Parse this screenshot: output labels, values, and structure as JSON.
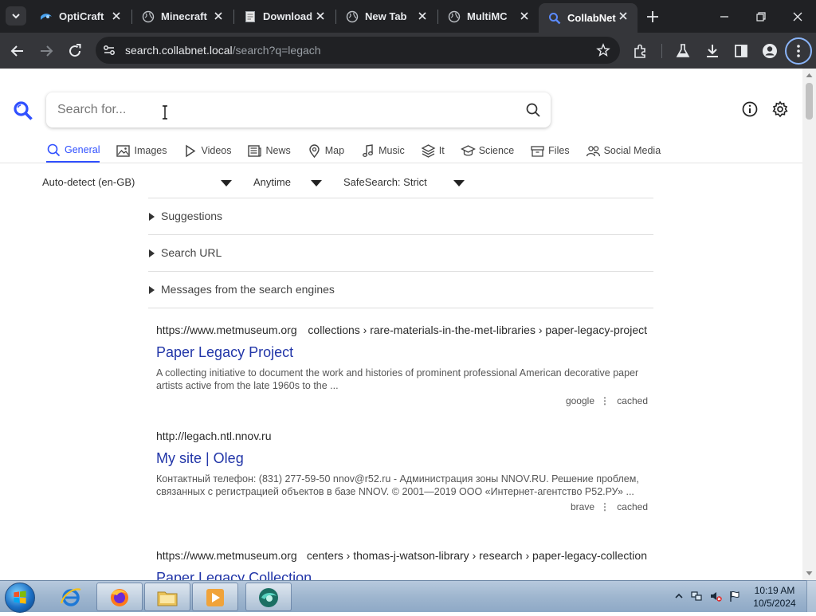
{
  "browser": {
    "tabs": [
      {
        "title": "OptiCraft",
        "icon": "opticraft-favicon",
        "active": false
      },
      {
        "title": "Minecraft",
        "icon": "globe-icon",
        "active": false
      },
      {
        "title": "Download",
        "icon": "document-icon",
        "active": false
      },
      {
        "title": "New Tab",
        "icon": "globe-icon",
        "active": false
      },
      {
        "title": "MultiMC",
        "icon": "globe-icon",
        "active": false
      },
      {
        "title": "CollabNet",
        "icon": "search-favicon",
        "active": true
      }
    ],
    "url_host": "search.collabnet.local",
    "url_path": "/search?q=legach"
  },
  "search": {
    "placeholder": "Search for...",
    "value": "",
    "categories": [
      "General",
      "Images",
      "Videos",
      "News",
      "Map",
      "Music",
      "It",
      "Science",
      "Files",
      "Social Media"
    ],
    "active_category": "General",
    "filters": {
      "language": "Auto-detect (en-GB)",
      "time": "Anytime",
      "safesearch": "SafeSearch: Strict"
    },
    "sections": [
      "Suggestions",
      "Search URL",
      "Messages from the search engines"
    ]
  },
  "results": [
    {
      "host": "https://www.metmuseum.org",
      "crumbs": "collections › rare-materials-in-the-met-libraries › paper-legacy-project",
      "title": "Paper Legacy Project",
      "snippet": "A collecting initiative to document the work and histories of prominent professional American decorative paper artists active from the late 1960s to the ...",
      "engine": "google",
      "cached": "cached"
    },
    {
      "host": "http://legach.ntl.nnov.ru",
      "crumbs": "",
      "title": "My site | Oleg",
      "snippet": "Контактный телефон: (831) 277-59-50 nnov@r52.ru - Администрация зоны NNOV.RU. Решение проблем, связанных с регистрацией объектов в базе NNOV. © 2001—2019 ООО «Интернет-агентство Р52.РУ» ...",
      "engine": "brave",
      "cached": "cached"
    },
    {
      "host": "https://www.metmuseum.org",
      "crumbs": "centers › thomas-j-watson-library › research › paper-legacy-collection",
      "title": "Paper Legacy Collection",
      "snippet": "",
      "engine": "",
      "cached": ""
    }
  ],
  "taskbar": {
    "apps": [
      "internet-explorer",
      "firefox",
      "file-explorer",
      "media-player",
      "collabnet-browser"
    ],
    "time": "10:19 AM",
    "date": "10/5/2024"
  },
  "colors": {
    "accent": "#3050ff",
    "title_link": "#2236a8",
    "chrome_dark": "#202124",
    "chrome_toolbar": "#35363a"
  }
}
